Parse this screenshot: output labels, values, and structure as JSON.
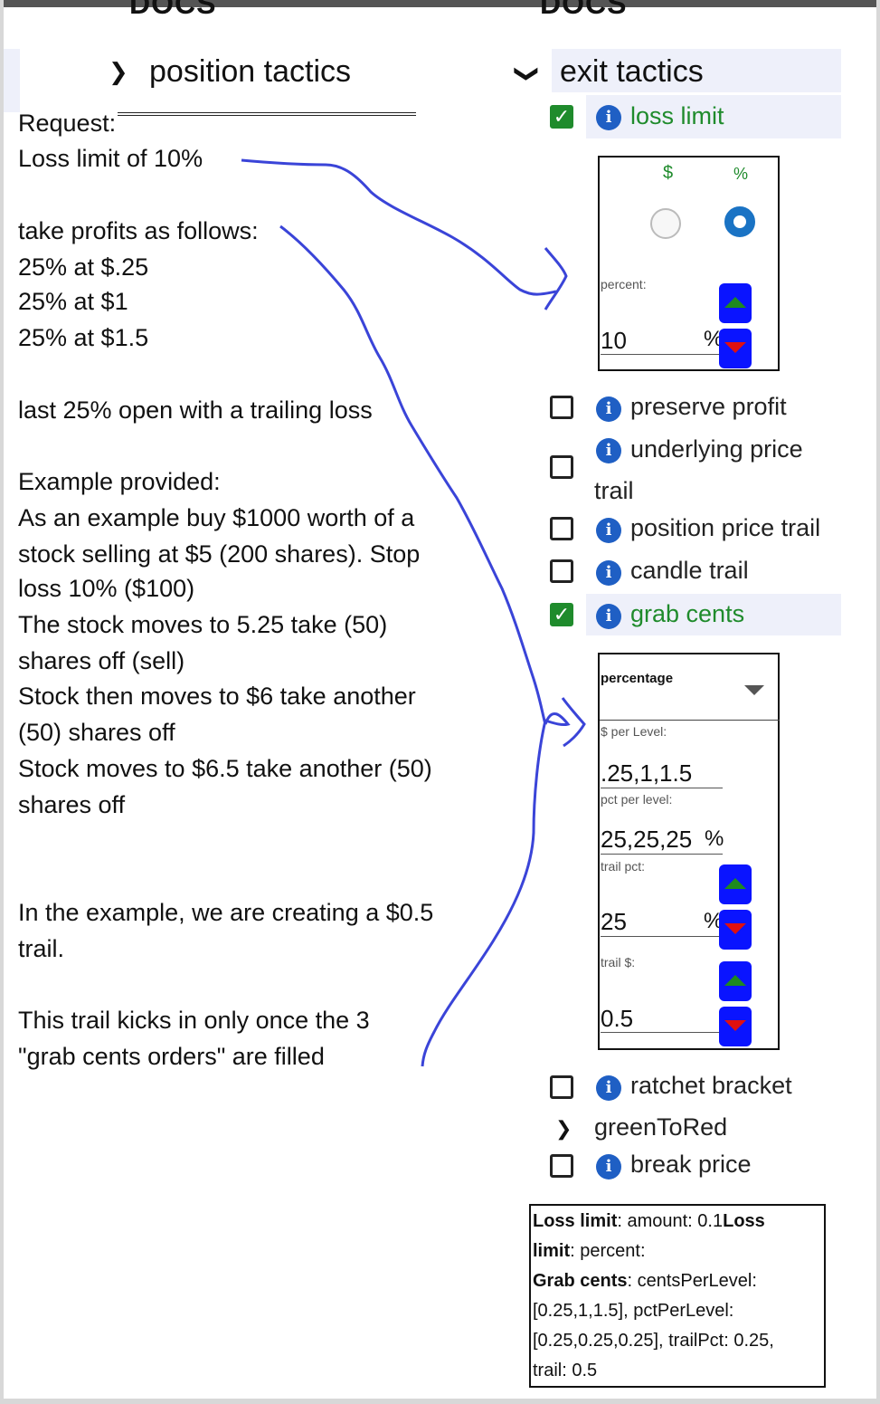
{
  "docs_left": "DOCS",
  "docs_right": "DOCS",
  "position_tactics": "position tactics",
  "exit_tactics": "exit tactics",
  "notes": {
    "request": "Request:",
    "loss_limit": "Loss limit of 10%",
    "take_profits": "take profits as follows:",
    "p1": "25% at $.25",
    "p2": "25% at $1",
    "p3": "25% at $1.5",
    "last": "last 25% open with a trailing loss",
    "example_title": "Example provided:",
    "ex1": "As an example buy $1000 worth of a",
    "ex2": "stock selling at $5 (200 shares). Stop",
    "ex3": "loss 10% ($100)",
    "ex4": "The stock moves to 5.25 take (50)",
    "ex5": "shares off (sell)",
    "ex6": "Stock then moves to $6 take another",
    "ex7": "(50) shares off",
    "ex8": "Stock moves to $6.5 take another (50)",
    "ex9": "shares off",
    "trail1": "In the example, we are creating a $0.5",
    "trail2": "trail.",
    "kick1": "This trail kicks in only once the 3",
    "kick2": "\"grab cents orders\" are filled"
  },
  "options": {
    "loss_limit": "loss limit",
    "preserve_profit": "preserve profit",
    "underlying_price": "underlying price",
    "trail": "trail",
    "position_price_trail": "position price trail",
    "candle_trail": "candle trail",
    "grab_cents": "grab cents",
    "ratchet_bracket": "ratchet bracket",
    "green_to_red": "greenToRed",
    "break_price": "break price"
  },
  "loss_box": {
    "dollar": "$",
    "percent": "%",
    "percent_label": "percent:",
    "value": "10",
    "unit": "%"
  },
  "grab_box": {
    "mode": "percentage",
    "per_level_label": "$ per Level:",
    "per_level_value": ".25,1,1.5",
    "pct_label": "pct per level:",
    "pct_value": "25,25,25",
    "pct_unit": "%",
    "trail_pct_label": "trail pct:",
    "trail_pct_value": "25",
    "trail_pct_unit": "%",
    "trail_dollar_label": "trail $:",
    "trail_dollar_value": "0.5"
  },
  "summary": {
    "l1_b": "Loss limit",
    "l1": ": amount: 0.1",
    "l1_b2": "Loss",
    "l2_b": "limit",
    "l2": ": percent:",
    "l3_b": "Grab cents",
    "l3": ": centsPerLevel:",
    "l4": "[0.25,1,1.5], pctPerLevel:",
    "l5": "[0.25,0.25,0.25], trailPct: 0.25,",
    "l6": "trail: 0.5"
  },
  "colors": {
    "accent_green": "#1f8b2c",
    "info_blue": "#1f5fc4",
    "spinner_blue": "#0a14ff",
    "ink_blue": "#3a44d8",
    "highlight": "#eef0fa"
  }
}
